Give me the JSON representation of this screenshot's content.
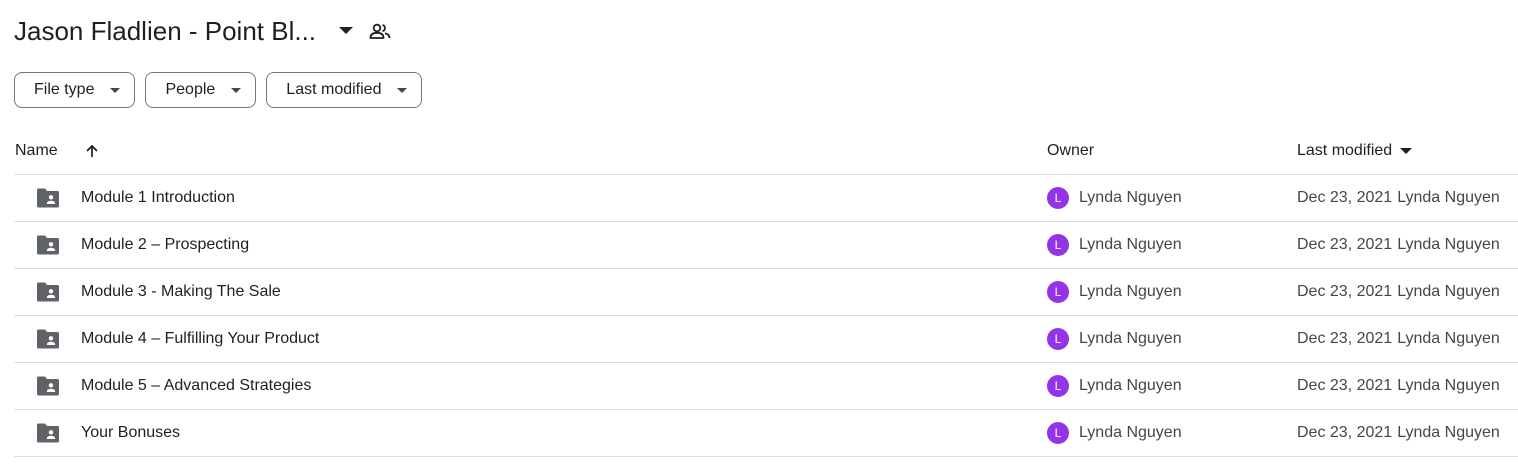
{
  "header": {
    "title": "Jason Fladlien - Point Bl...",
    "title_dropdown_icon": "arrow-drop-down-icon",
    "share_icon": "people-icon"
  },
  "filters": [
    {
      "label": "File type"
    },
    {
      "label": "People"
    },
    {
      "label": "Last modified"
    }
  ],
  "table": {
    "columns": {
      "name": "Name",
      "owner": "Owner",
      "last_modified": "Last modified"
    },
    "sort": {
      "column": "name",
      "direction": "ascending",
      "icon": "arrow-up-icon"
    },
    "rows": [
      {
        "name": "Module 1 Introduction",
        "owner": "Lynda Nguyen",
        "owner_initial": "L",
        "modified_date": "Dec 23, 2021",
        "modified_by": "Lynda Nguyen"
      },
      {
        "name": "Module 2 – Prospecting",
        "owner": "Lynda Nguyen",
        "owner_initial": "L",
        "modified_date": "Dec 23, 2021",
        "modified_by": "Lynda Nguyen"
      },
      {
        "name": "Module 3 - Making The Sale",
        "owner": "Lynda Nguyen",
        "owner_initial": "L",
        "modified_date": "Dec 23, 2021",
        "modified_by": "Lynda Nguyen"
      },
      {
        "name": "Module 4 – Fulfilling Your Product",
        "owner": "Lynda Nguyen",
        "owner_initial": "L",
        "modified_date": "Dec 23, 2021",
        "modified_by": "Lynda Nguyen"
      },
      {
        "name": "Module 5 – Advanced Strategies",
        "owner": "Lynda Nguyen",
        "owner_initial": "L",
        "modified_date": "Dec 23, 2021",
        "modified_by": "Lynda Nguyen"
      },
      {
        "name": "Your Bonuses",
        "owner": "Lynda Nguyen",
        "owner_initial": "L",
        "modified_date": "Dec 23, 2021",
        "modified_by": "Lynda Nguyen"
      }
    ]
  },
  "colors": {
    "avatar_bg": "#9334e6",
    "icon": "#5f6368",
    "divider": "#dadce0",
    "chip_border": "#747775"
  }
}
